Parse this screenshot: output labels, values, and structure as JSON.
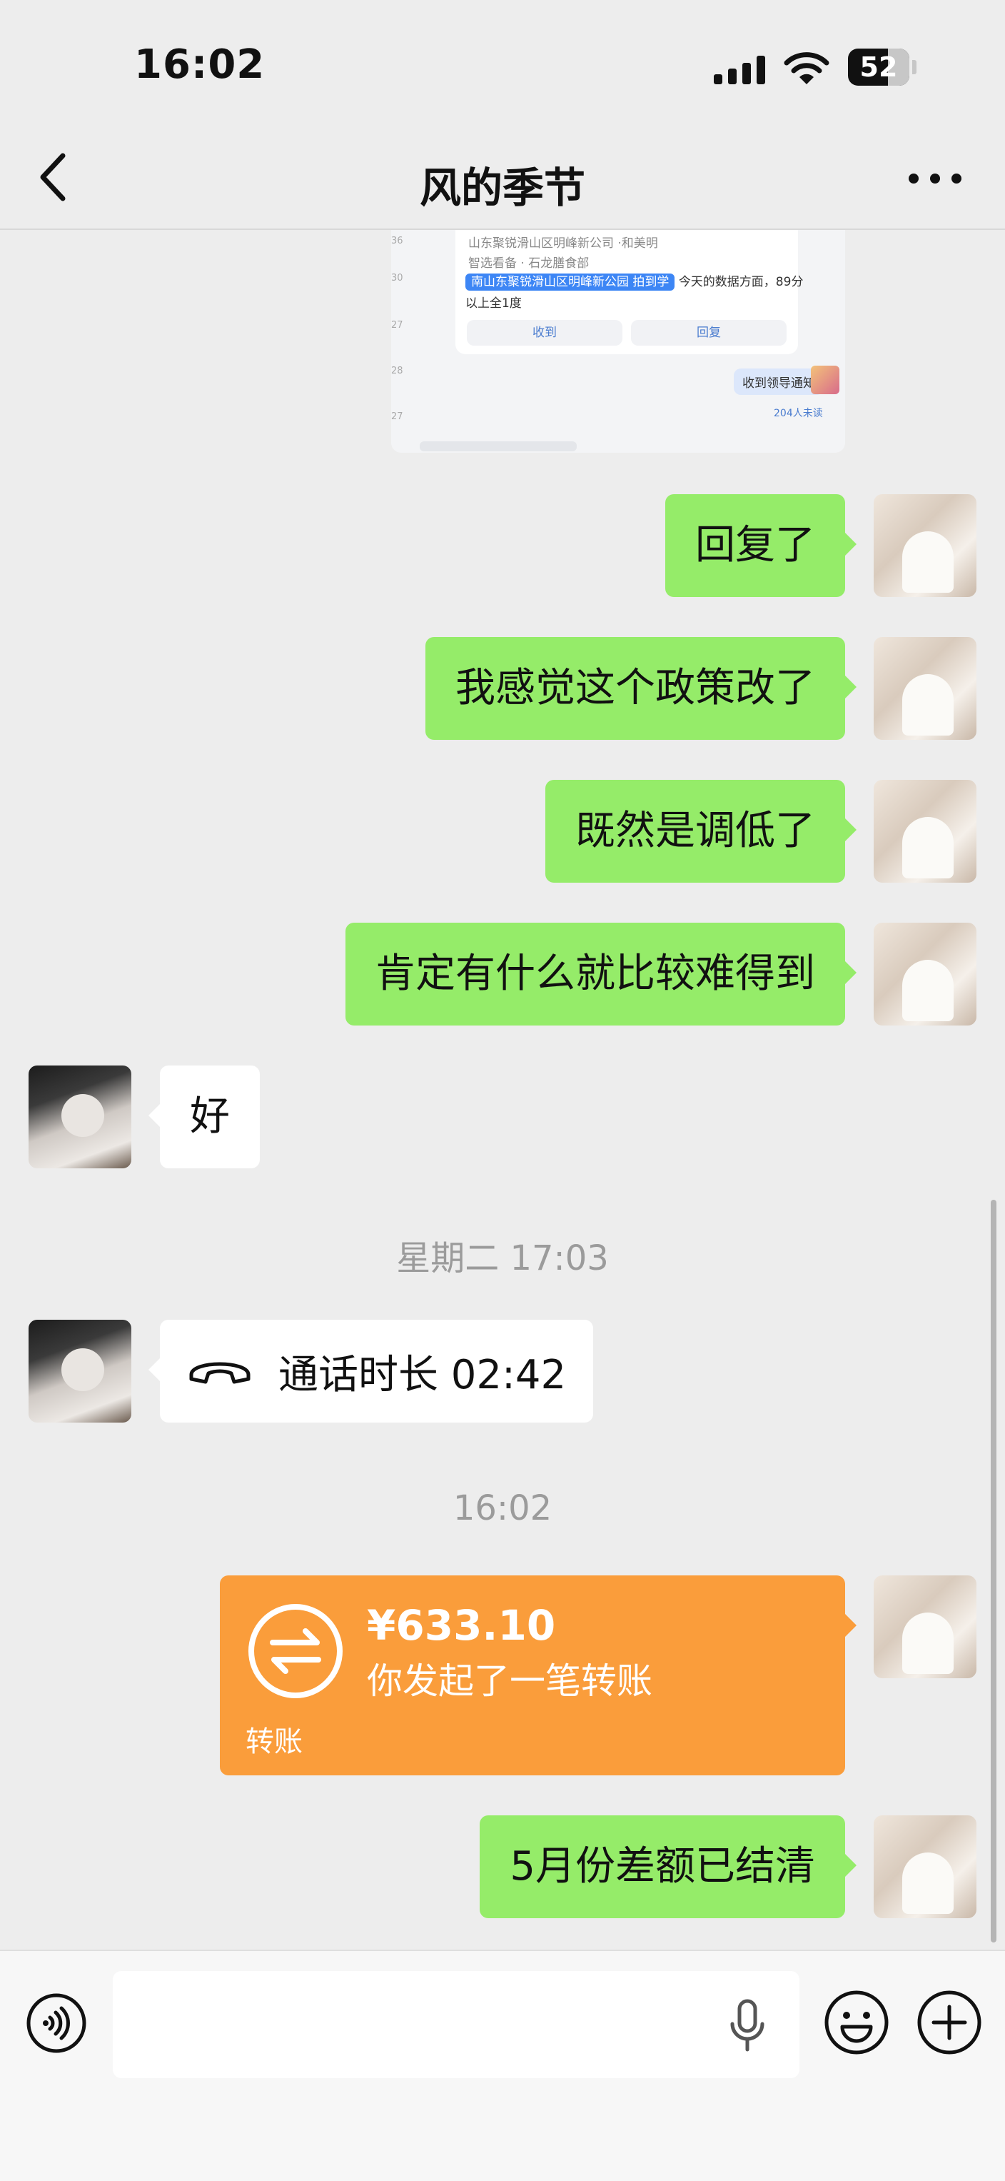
{
  "status_bar": {
    "time": "16:02",
    "battery": "52"
  },
  "header": {
    "title": "风的季节",
    "back_icon": "chevron-left-icon",
    "more_icon": "more-dots-icon"
  },
  "shared_screenshot": {
    "line1": "山东聚锐滑山区明峰新公司 ·和美明",
    "line2": "智选看备 · 石龙膳食部",
    "chip": "南山东聚锐滑山区明峰新公园 拍到学",
    "chip_tail": "今天的数据方面，89分",
    "line3": "以上全1度",
    "button_received": "收到",
    "button_reply": "回复",
    "reply_text": "收到领导通知",
    "read_count": "204人未读"
  },
  "messages": {
    "m1": "回复了",
    "m2": "我感觉这个政策改了",
    "m3": "既然是调低了",
    "m4": "肯定有什么就比较难得到",
    "m5": "好",
    "time1": "星期二 17:03",
    "call": "通话时长 02:42",
    "time2": "16:02",
    "transfer": {
      "amount": "¥633.10",
      "description": "你发起了一笔转账",
      "label": "转账"
    },
    "m6": "5月份差额已结清"
  },
  "colors": {
    "bubble_me": "#95ec69",
    "bubble_other": "#ffffff",
    "transfer": "#fa9d3b",
    "background": "#ededed"
  },
  "input": {
    "placeholder": ""
  }
}
